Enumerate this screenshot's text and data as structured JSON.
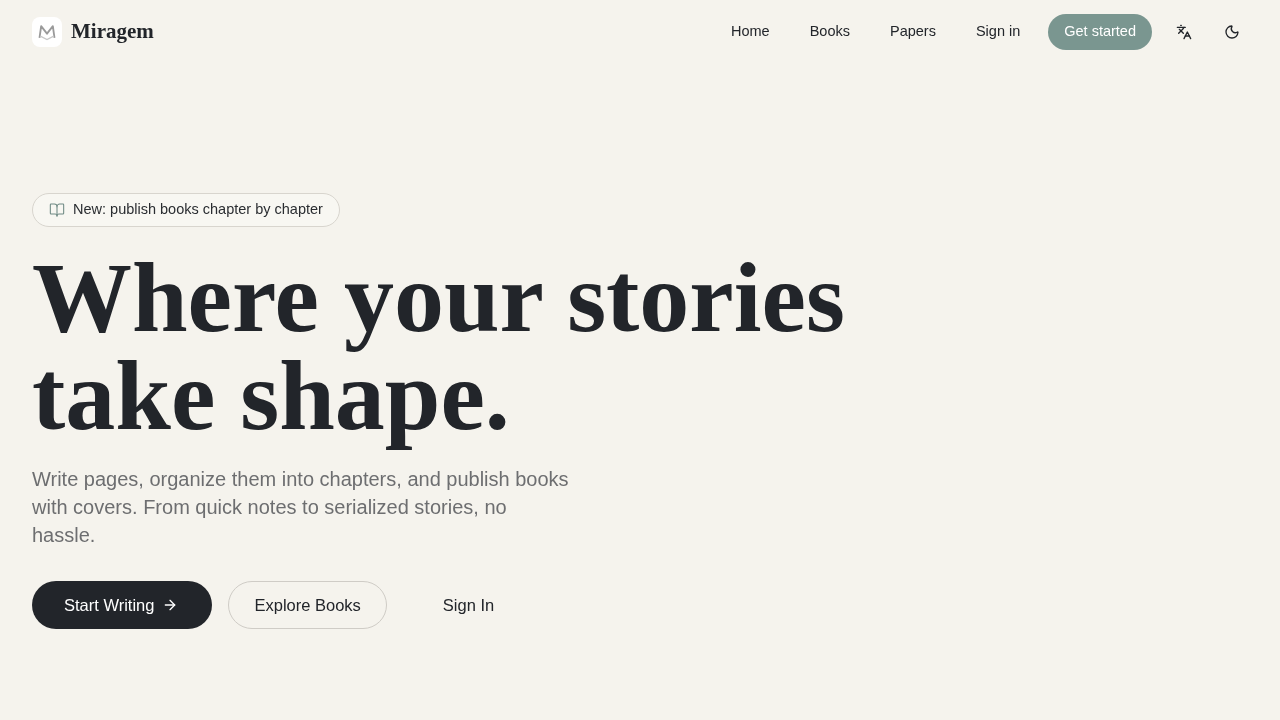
{
  "header": {
    "brand": "Miragem",
    "nav": [
      {
        "label": "Home"
      },
      {
        "label": "Books"
      },
      {
        "label": "Papers"
      },
      {
        "label": "Sign in"
      }
    ],
    "cta": "Get started"
  },
  "hero": {
    "badge": "New: publish books chapter by chapter",
    "headline_lines": [
      "Where your stories",
      "take shape."
    ],
    "subtitle": "Write pages, organize them into chapters, and publish books with covers. From quick notes to serialized stories, no hassle.",
    "actions": [
      {
        "kind": "primary",
        "label": "Start Writing"
      },
      {
        "kind": "outline",
        "label": "Explore Books"
      },
      {
        "kind": "plain",
        "label": "Sign In"
      }
    ]
  }
}
